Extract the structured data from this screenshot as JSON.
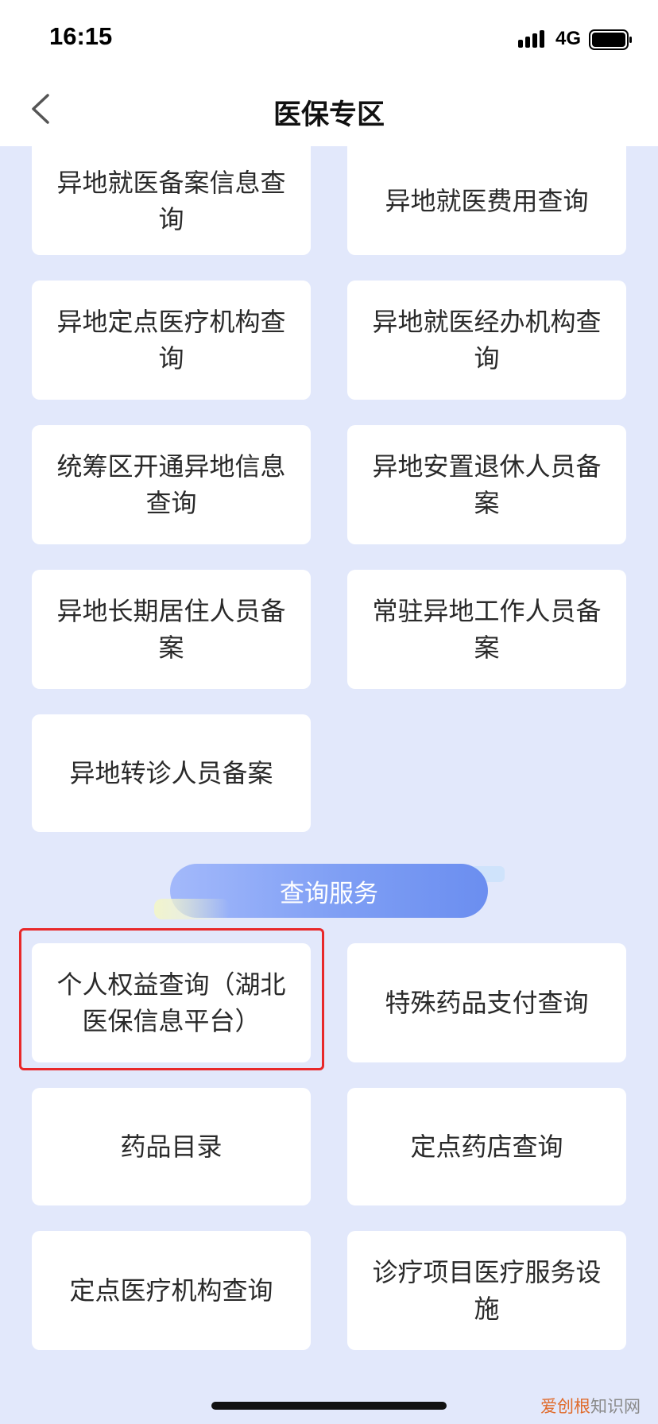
{
  "status_bar": {
    "time": "16:15",
    "network": "4G",
    "icons": [
      "signal-icon",
      "battery-icon"
    ]
  },
  "header": {
    "title": "医保专区",
    "back_icon": "chevron-left-icon"
  },
  "remote_medical_items": [
    "异地就医备案信息查询",
    "异地就医费用查询",
    "异地定点医疗机构查询",
    "异地就医经办机构查询",
    "统筹区开通异地信息查询",
    "异地安置退休人员备案",
    "异地长期居住人员备案",
    "常驻异地工作人员备案",
    "异地转诊人员备案"
  ],
  "query_section": {
    "title": "查询服务",
    "items": [
      "个人权益查询（湖北医保信息平台）",
      "特殊药品支付查询",
      "药品目录",
      "定点药店查询",
      "定点医疗机构查询",
      "诊疗项目医疗服务设施"
    ],
    "highlight_color": "#e8282a"
  },
  "watermark": {
    "brand": "爱创根",
    "suffix": "知识网"
  },
  "colors": {
    "page_background": "#e2e8fb",
    "card_background": "#ffffff",
    "section_header_accent": "#7e9ef4"
  }
}
